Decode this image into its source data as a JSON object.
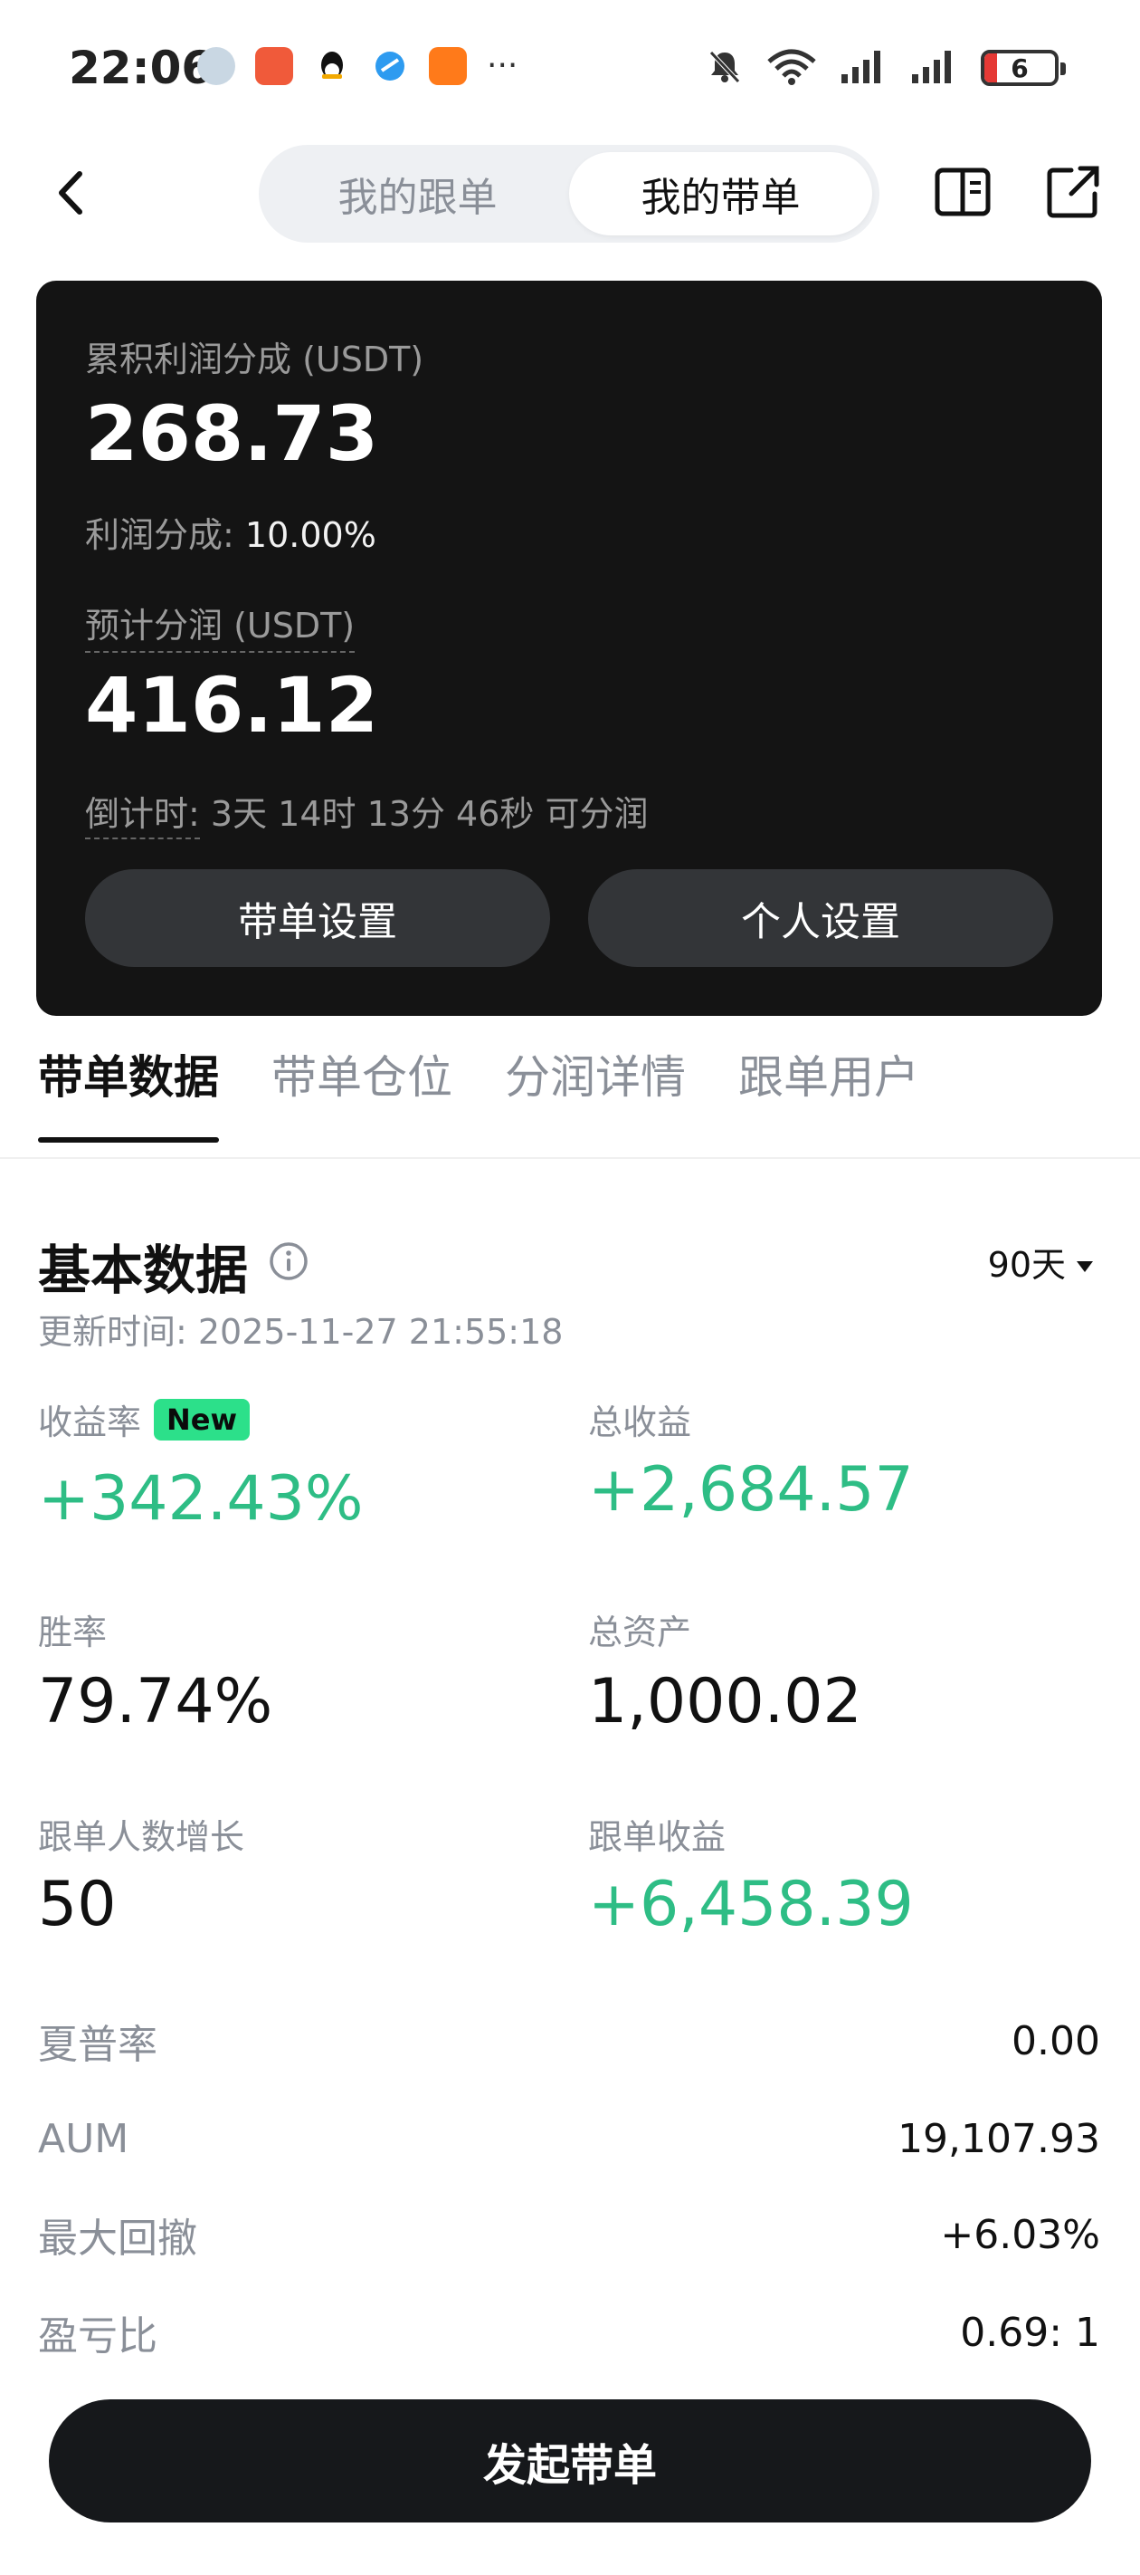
{
  "status_bar": {
    "time": "22:06",
    "app_icons": [
      "avatar-icon",
      "badge-app-icon",
      "qq-icon",
      "browser-icon",
      "orange-app-icon"
    ],
    "more": "···",
    "battery": "6",
    "colors": {
      "battery_low": "#e53935"
    }
  },
  "header": {
    "tabs": [
      {
        "label": "我的跟单",
        "active": false
      },
      {
        "label": "我的带单",
        "active": true
      }
    ]
  },
  "card": {
    "profit_share_label": "累积利润分成 (USDT)",
    "profit_share_value": "268.73",
    "rate_label": "利润分成:",
    "rate_value": "10.00%",
    "expected_label": "预计分润 (USDT)",
    "expected_value": "416.12",
    "countdown_label": "倒计时:",
    "countdown_value": "3天 14时 13分 46秒 可分润",
    "btn_left": "带单设置",
    "btn_right": "个人设置"
  },
  "tabs": [
    {
      "label": "带单数据",
      "active": true
    },
    {
      "label": "带单仓位",
      "active": false
    },
    {
      "label": "分润详情",
      "active": false
    },
    {
      "label": "跟单用户",
      "active": false
    }
  ],
  "basic": {
    "title": "基本数据",
    "range": "90天",
    "updated": "更新时间: 2025-11-27 21:55:18",
    "metrics": {
      "yield_label": "收益率",
      "yield_badge": "New",
      "yield_value": "+342.43%",
      "total_profit_label": "总收益",
      "total_profit_value": "+2,684.57",
      "win_rate_label": "胜率",
      "win_rate_value": "79.74%",
      "total_assets_label": "总资产",
      "total_assets_value": "1,000.02",
      "followers_growth_label": "跟单人数增长",
      "followers_growth_value": "50",
      "follow_profit_label": "跟单收益",
      "follow_profit_value": "+6,458.39"
    },
    "rows": [
      {
        "k": "夏普率",
        "v": "0.00"
      },
      {
        "k": "AUM",
        "v": "19,107.93"
      },
      {
        "k": "最大回撤",
        "v": "+6.03%"
      },
      {
        "k": "盈亏比",
        "v": "0.69: 1"
      }
    ],
    "colors": {
      "positive": "#2ebd85",
      "badge": "#2ce08a"
    }
  },
  "cta": {
    "label": "发起带单"
  }
}
